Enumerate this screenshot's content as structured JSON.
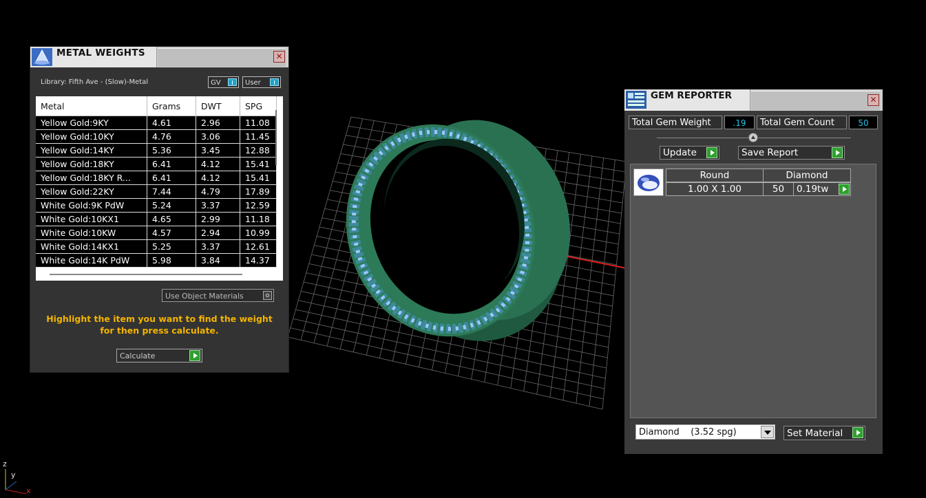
{
  "metal_weights": {
    "title": "METAL WEIGHTS",
    "library_label": "Library: Fifth Ave - (Slow)-Metal",
    "toggle_gv": "GV",
    "toggle_user": "User",
    "columns": [
      "Metal",
      "Grams",
      "DWT",
      "SPG"
    ],
    "rows": [
      [
        "Yellow Gold:9KY",
        "4.61",
        "2.96",
        "11.08"
      ],
      [
        "Yellow Gold:10KY",
        "4.76",
        "3.06",
        "11.45"
      ],
      [
        "Yellow Gold:14KY",
        "5.36",
        "3.45",
        "12.88"
      ],
      [
        "Yellow Gold:18KY",
        "6.41",
        "4.12",
        "15.41"
      ],
      [
        "Yellow Gold:18KY R...",
        "6.41",
        "4.12",
        "15.41"
      ],
      [
        "Yellow Gold:22KY",
        "7.44",
        "4.79",
        "17.89"
      ],
      [
        "White Gold:9K PdW",
        "5.24",
        "3.37",
        "12.59"
      ],
      [
        "White Gold:10KX1",
        "4.65",
        "2.99",
        "11.18"
      ],
      [
        "White Gold:10KW",
        "4.57",
        "2.94",
        "10.99"
      ],
      [
        "White Gold:14KX1",
        "5.25",
        "3.37",
        "12.61"
      ],
      [
        "White Gold:14K PdW",
        "5.98",
        "3.84",
        "14.37"
      ]
    ],
    "use_object_materials": "Use Object Materials",
    "hint": "Highlight the item you want to find the weight for then press calculate.",
    "calculate_label": "Calculate"
  },
  "gem_reporter": {
    "title": "GEM REPORTER",
    "total_weight_label": "Total Gem Weight",
    "total_weight_value": ".19",
    "total_count_label": "Total Gem Count",
    "total_count_value": "50",
    "update_label": "Update",
    "save_report_label": "Save Report",
    "gem": {
      "shape": "Round",
      "material": "Diamond",
      "size": "1.00 X 1.00",
      "count": "50",
      "weight": "0.19tw"
    },
    "material_select": "Diamond    (3.52 spg)",
    "set_material_label": "Set Material"
  },
  "axis_labels": {
    "z": "z",
    "y": "y",
    "x": "x"
  },
  "colors": {
    "accent_cyan": "#29c3ee",
    "button_green": "#2fa02f",
    "hint_yellow": "#f4b400",
    "ring_green": "#2a6b4e"
  }
}
